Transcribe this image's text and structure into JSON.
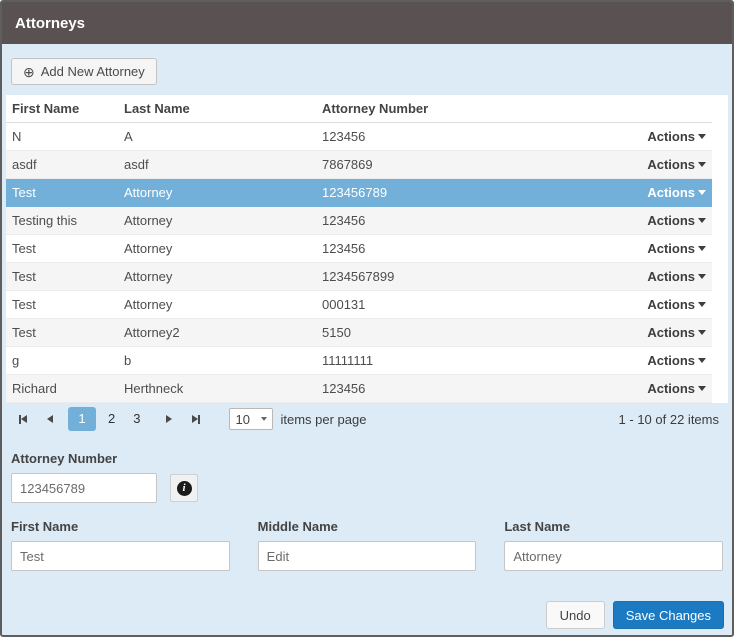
{
  "header": {
    "title": "Attorneys"
  },
  "toolbar": {
    "add_button": "Add New Attorney",
    "add_icon": "⊕"
  },
  "table": {
    "columns": [
      "First Name",
      "Last Name",
      "Attorney Number"
    ],
    "actions_label": "Actions",
    "selected_index": 2,
    "rows": [
      {
        "first": "N",
        "last": "A",
        "number": "123456"
      },
      {
        "first": "asdf",
        "last": "asdf",
        "number": "7867869"
      },
      {
        "first": "Test",
        "last": "Attorney",
        "number": "123456789"
      },
      {
        "first": "Testing this",
        "last": "Attorney",
        "number": "123456"
      },
      {
        "first": "Test",
        "last": "Attorney",
        "number": "123456"
      },
      {
        "first": "Test",
        "last": "Attorney",
        "number": "1234567899"
      },
      {
        "first": "Test",
        "last": "Attorney",
        "number": "000131"
      },
      {
        "first": "Test",
        "last": "Attorney2",
        "number": "5150"
      },
      {
        "first": "g",
        "last": "b",
        "number": "11111111"
      },
      {
        "first": "Richard",
        "last": "Herthneck",
        "number": "123456"
      }
    ]
  },
  "pager": {
    "pages": [
      "1",
      "2",
      "3"
    ],
    "current_page": "1",
    "page_size": "10",
    "items_per_page_label": "items per page",
    "range_label": "1 - 10 of 22 items"
  },
  "form": {
    "attorney_number": {
      "label": "Attorney Number",
      "value": "123456789"
    },
    "first_name": {
      "label": "First Name",
      "value": "Test"
    },
    "middle_name": {
      "label": "Middle Name",
      "value": "Edit"
    },
    "last_name": {
      "label": "Last Name",
      "value": "Attorney"
    },
    "info_icon_glyph": "i"
  },
  "footer": {
    "undo_label": "Undo",
    "save_label": "Save Changes"
  },
  "colors": {
    "titlebar_bg": "#5a5152",
    "panel_bg": "#dcebf6",
    "selected_row": "#72b0d9",
    "save_button": "#1b7ac2",
    "middle_name_highlight": "#fdf6df"
  }
}
